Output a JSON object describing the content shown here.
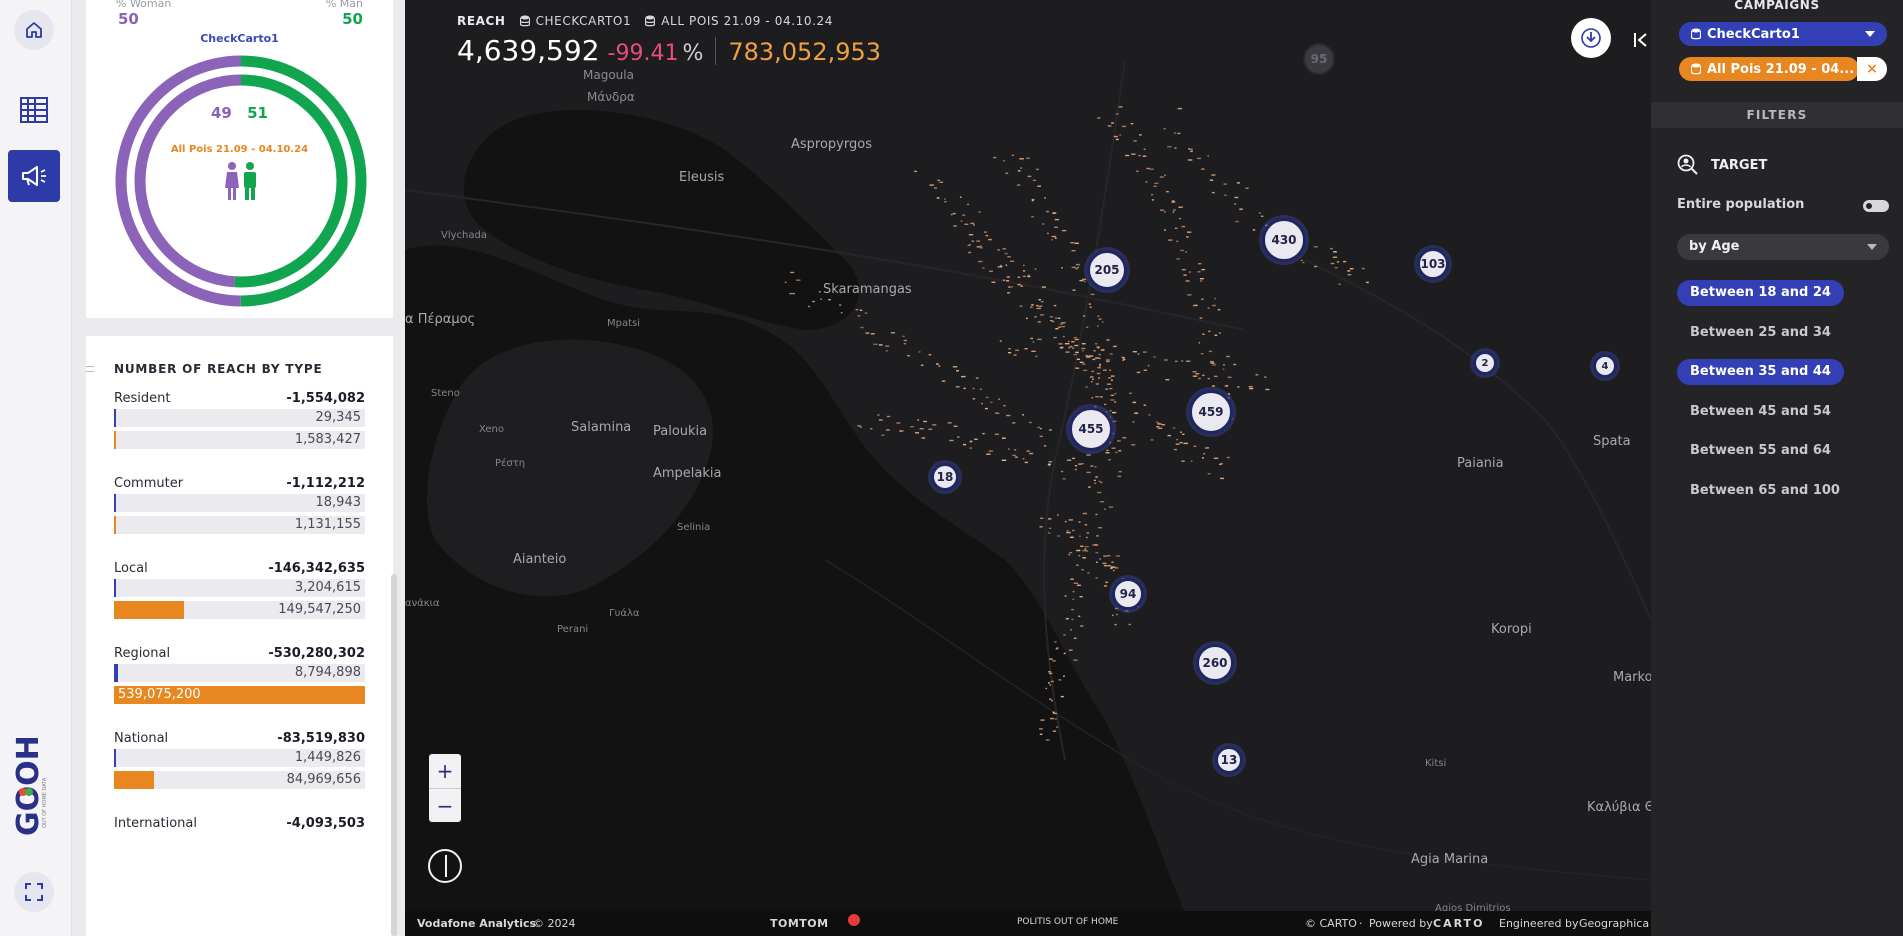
{
  "nav": {
    "home": "home-icon",
    "dashboard": "grid-icon",
    "campaigns": "megaphone-icon",
    "expand": "fullscreen-icon",
    "logo_text": "GOOH",
    "logo_sub": "OUT OF HOME DATA"
  },
  "gender": {
    "woman_label": "% Woman",
    "woman_value": "50",
    "man_label": "% Man",
    "man_value": "50",
    "campaign_name": "CheckCarto1",
    "inner_woman": "49",
    "inner_man": "51",
    "inner_label": "All Pois 21.09 - 04.10.24",
    "outer_woman_fraction": 0.5,
    "inner_woman_fraction": 0.49,
    "woman_color": "#8b63b8",
    "man_color": "#12a550"
  },
  "reach": {
    "title": "NUMBER OF REACH BY TYPE",
    "groups": [
      {
        "name": "Resident",
        "total": "-1,554,082",
        "bar1": "29,345",
        "bar2": "1,583,427",
        "frac1": 0.0,
        "frac2": 0.003
      },
      {
        "name": "Commuter",
        "total": "-1,112,212",
        "bar1": "18,943",
        "bar2": "1,131,155",
        "frac1": 0.0,
        "frac2": 0.002
      },
      {
        "name": "Local",
        "total": "-146,342,635",
        "bar1": "3,204,615",
        "bar2": "149,547,250",
        "frac1": 0.006,
        "frac2": 0.277
      },
      {
        "name": "Regional",
        "total": "-530,280,302",
        "bar1": "8,794,898",
        "bar2": "539,075,200",
        "frac1": 0.016,
        "frac2": 1.0
      },
      {
        "name": "National",
        "total": "-83,519,830",
        "bar1": "1,449,826",
        "bar2": "84,969,656",
        "frac1": 0.003,
        "frac2": 0.158
      },
      {
        "name": "International",
        "total": "-4,093,503"
      }
    ],
    "blue_color": "#3340b5",
    "orange_color": "#e8861f"
  },
  "header": {
    "reach_label": "REACH",
    "campaign": "CHECKCARTO1",
    "poi_set": "ALL POIS 21.09 - 04.10.24",
    "main_value": "4,639,592",
    "delta": "-99.41",
    "pct": "%",
    "compare_value": "783,052,953"
  },
  "map": {
    "places": [
      {
        "name": "Magoula",
        "cls": ""
      },
      {
        "name": "Μάνδρα",
        "cls": ""
      },
      {
        "name": "Aspropyrgos",
        "cls": "big"
      },
      {
        "name": "Eleusis",
        "cls": "big"
      },
      {
        "name": "Vlychada",
        "cls": "sm"
      },
      {
        "name": "Skaramangas",
        "cls": "big"
      },
      {
        "name": "α Πέραμος",
        "cls": "big"
      },
      {
        "name": "Mpatsi",
        "cls": "sm"
      },
      {
        "name": "Steno",
        "cls": "sm"
      },
      {
        "name": "Xeno",
        "cls": "sm"
      },
      {
        "name": "Salamina",
        "cls": "big"
      },
      {
        "name": "Paloukia",
        "cls": "big"
      },
      {
        "name": "Ρέστη",
        "cls": "sm"
      },
      {
        "name": "Ampelakia",
        "cls": "big"
      },
      {
        "name": "Selinia",
        "cls": "sm"
      },
      {
        "name": "Aianteio",
        "cls": "big"
      },
      {
        "name": "ανάκια",
        "cls": "sm"
      },
      {
        "name": "Γυάλα",
        "cls": "sm"
      },
      {
        "name": "Perani",
        "cls": "sm"
      },
      {
        "name": "Paiania",
        "cls": "big"
      },
      {
        "name": "Spata",
        "cls": "big"
      },
      {
        "name": "Koropi",
        "cls": "big"
      },
      {
        "name": "Marko",
        "cls": "big"
      },
      {
        "name": "Kitsi",
        "cls": "sm"
      },
      {
        "name": "Καλύβια Θ",
        "cls": "big"
      },
      {
        "name": "Agia Marina",
        "cls": "big"
      },
      {
        "name": "Agios Dimitrios",
        "cls": "sm"
      }
    ],
    "clusters": [
      "95",
      "430",
      "205",
      "103",
      "2",
      "4",
      "459",
      "455",
      "18",
      "94",
      "260",
      "13"
    ],
    "zoom_in": "+",
    "zoom_out": "−"
  },
  "attribution": {
    "vodafone": "Vodafone Analytics",
    "year": "© 2024",
    "tomtom": "TOMTOM",
    "politis": "POLITIS OUT OF HOME",
    "carto": "© CARTO",
    "dot": "·",
    "powered": "Powered by",
    "carto_brand": "CARTO",
    "engineered": "Engineered by",
    "geographica": "Geographica"
  },
  "right_panel": {
    "campaigns_title": "CAMPAIGNS",
    "campaign_pill": "CheckCarto1",
    "poi_pill": "All Pois 21.09 - 04...",
    "remove": "×",
    "filters_title": "FILTERS",
    "target_label": "TARGET",
    "entire_population": "Entire population",
    "select_value": "by Age",
    "ages": [
      {
        "label": "Between 18 and 24",
        "selected": true
      },
      {
        "label": "Between 25 and 34",
        "selected": false
      },
      {
        "label": "Between 35 and 44",
        "selected": true
      },
      {
        "label": "Between 45 and 54",
        "selected": false
      },
      {
        "label": "Between 55 and 64",
        "selected": false
      },
      {
        "label": "Between 65 and 100",
        "selected": false
      }
    ]
  }
}
